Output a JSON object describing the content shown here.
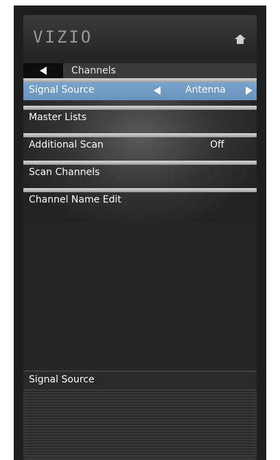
{
  "brand": {
    "logo_text": "VIZIO"
  },
  "header": {
    "home_icon": "home-icon",
    "back_icon": "left-arrow-icon",
    "title": "Channels"
  },
  "menu": {
    "items": [
      {
        "label": "Signal Source",
        "value": "Antenna",
        "selected": true
      },
      {
        "label": "Master Lists",
        "value": ""
      },
      {
        "label": "Additional Scan",
        "value": "Off"
      },
      {
        "label": "Scan Channels",
        "value": ""
      },
      {
        "label": "Channel Name Edit",
        "value": ""
      }
    ]
  },
  "footer": {
    "description_title": "Signal Source"
  },
  "colors": {
    "selected_row": "#7aa7d2",
    "panel_bg": "#262626",
    "text": "#ffffff"
  }
}
